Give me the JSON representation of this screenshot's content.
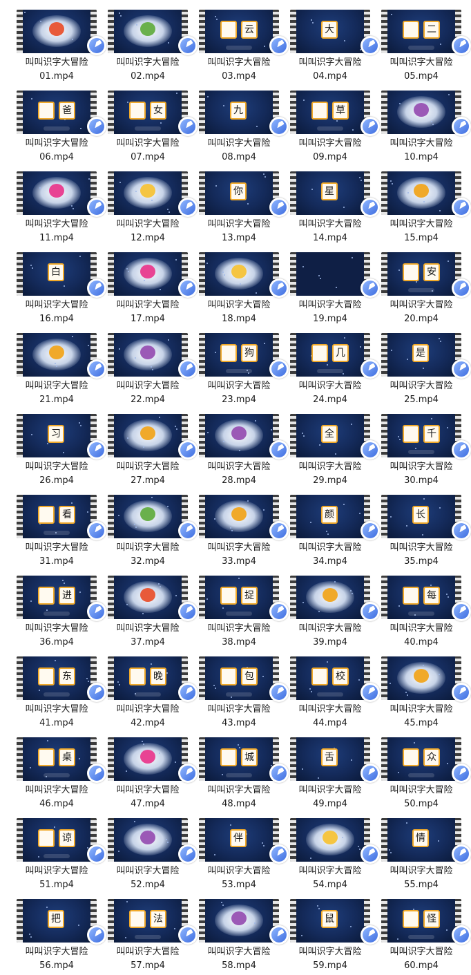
{
  "file_name_prefix": "叫叫识字大冒险",
  "items": [
    {
      "ext_name": "01.mp4",
      "chars": [],
      "thumb": "art"
    },
    {
      "ext_name": "02.mp4",
      "chars": [],
      "thumb": "art"
    },
    {
      "ext_name": "03.mp4",
      "chars": [
        "",
        "云"
      ],
      "thumb": "card"
    },
    {
      "ext_name": "04.mp4",
      "chars": [
        "大"
      ],
      "thumb": "card"
    },
    {
      "ext_name": "05.mp4",
      "chars": [
        "",
        "二"
      ],
      "thumb": "card"
    },
    {
      "ext_name": "06.mp4",
      "chars": [
        "",
        "爸"
      ],
      "thumb": "card"
    },
    {
      "ext_name": "07.mp4",
      "chars": [
        "",
        "女"
      ],
      "thumb": "card"
    },
    {
      "ext_name": "08.mp4",
      "chars": [
        "九"
      ],
      "thumb": "card"
    },
    {
      "ext_name": "09.mp4",
      "chars": [
        "",
        "草"
      ],
      "thumb": "card"
    },
    {
      "ext_name": "10.mp4",
      "chars": [],
      "thumb": "art"
    },
    {
      "ext_name": "11.mp4",
      "chars": [],
      "thumb": "art"
    },
    {
      "ext_name": "12.mp4",
      "chars": [],
      "thumb": "art"
    },
    {
      "ext_name": "13.mp4",
      "chars": [
        "你"
      ],
      "thumb": "card"
    },
    {
      "ext_name": "14.mp4",
      "chars": [
        "星"
      ],
      "thumb": "card"
    },
    {
      "ext_name": "15.mp4",
      "chars": [],
      "thumb": "art"
    },
    {
      "ext_name": "16.mp4",
      "chars": [
        "白"
      ],
      "thumb": "card"
    },
    {
      "ext_name": "17.mp4",
      "chars": [],
      "thumb": "art"
    },
    {
      "ext_name": "18.mp4",
      "chars": [],
      "thumb": "art"
    },
    {
      "ext_name": "19.mp4",
      "chars": [],
      "thumb": "dark"
    },
    {
      "ext_name": "20.mp4",
      "chars": [
        "",
        "安"
      ],
      "thumb": "card"
    },
    {
      "ext_name": "21.mp4",
      "chars": [],
      "thumb": "art"
    },
    {
      "ext_name": "22.mp4",
      "chars": [],
      "thumb": "art"
    },
    {
      "ext_name": "23.mp4",
      "chars": [
        "",
        "狗"
      ],
      "thumb": "card"
    },
    {
      "ext_name": "24.mp4",
      "chars": [
        "",
        "几"
      ],
      "thumb": "card"
    },
    {
      "ext_name": "25.mp4",
      "chars": [
        "是"
      ],
      "thumb": "card"
    },
    {
      "ext_name": "26.mp4",
      "chars": [
        "习"
      ],
      "thumb": "card"
    },
    {
      "ext_name": "27.mp4",
      "chars": [],
      "thumb": "art"
    },
    {
      "ext_name": "28.mp4",
      "chars": [],
      "thumb": "art"
    },
    {
      "ext_name": "29.mp4",
      "chars": [
        "全"
      ],
      "thumb": "card"
    },
    {
      "ext_name": "30.mp4",
      "chars": [
        "",
        "千"
      ],
      "thumb": "card"
    },
    {
      "ext_name": "31.mp4",
      "chars": [
        "",
        "看"
      ],
      "thumb": "card"
    },
    {
      "ext_name": "32.mp4",
      "chars": [],
      "thumb": "art"
    },
    {
      "ext_name": "33.mp4",
      "chars": [],
      "thumb": "art"
    },
    {
      "ext_name": "34.mp4",
      "chars": [
        "颜"
      ],
      "thumb": "card"
    },
    {
      "ext_name": "35.mp4",
      "chars": [
        "长"
      ],
      "thumb": "card"
    },
    {
      "ext_name": "36.mp4",
      "chars": [
        "",
        "进"
      ],
      "thumb": "card"
    },
    {
      "ext_name": "37.mp4",
      "chars": [],
      "thumb": "art"
    },
    {
      "ext_name": "38.mp4",
      "chars": [
        "",
        "捉"
      ],
      "thumb": "card"
    },
    {
      "ext_name": "39.mp4",
      "chars": [],
      "thumb": "art"
    },
    {
      "ext_name": "40.mp4",
      "chars": [
        "",
        "每"
      ],
      "thumb": "card"
    },
    {
      "ext_name": "41.mp4",
      "chars": [
        "",
        "东"
      ],
      "thumb": "card"
    },
    {
      "ext_name": "42.mp4",
      "chars": [
        "",
        "晚"
      ],
      "thumb": "card"
    },
    {
      "ext_name": "43.mp4",
      "chars": [
        "",
        "包"
      ],
      "thumb": "card"
    },
    {
      "ext_name": "44.mp4",
      "chars": [
        "",
        "校"
      ],
      "thumb": "card"
    },
    {
      "ext_name": "45.mp4",
      "chars": [],
      "thumb": "art"
    },
    {
      "ext_name": "46.mp4",
      "chars": [
        "",
        "桌"
      ],
      "thumb": "card"
    },
    {
      "ext_name": "47.mp4",
      "chars": [],
      "thumb": "art"
    },
    {
      "ext_name": "48.mp4",
      "chars": [
        "",
        "城"
      ],
      "thumb": "card"
    },
    {
      "ext_name": "49.mp4",
      "chars": [
        "舌"
      ],
      "thumb": "card"
    },
    {
      "ext_name": "50.mp4",
      "chars": [
        "",
        "众"
      ],
      "thumb": "card"
    },
    {
      "ext_name": "51.mp4",
      "chars": [
        "",
        "谅"
      ],
      "thumb": "card"
    },
    {
      "ext_name": "52.mp4",
      "chars": [],
      "thumb": "art"
    },
    {
      "ext_name": "53.mp4",
      "chars": [
        "伴"
      ],
      "thumb": "card"
    },
    {
      "ext_name": "54.mp4",
      "chars": [],
      "thumb": "art"
    },
    {
      "ext_name": "55.mp4",
      "chars": [
        "情"
      ],
      "thumb": "card"
    },
    {
      "ext_name": "56.mp4",
      "chars": [
        "把"
      ],
      "thumb": "card"
    },
    {
      "ext_name": "57.mp4",
      "chars": [
        "",
        "法"
      ],
      "thumb": "card"
    },
    {
      "ext_name": "58.mp4",
      "chars": [],
      "thumb": "art"
    },
    {
      "ext_name": "59.mp4",
      "chars": [
        "鼠"
      ],
      "thumb": "card"
    },
    {
      "ext_name": "60.mp4",
      "chars": [
        "",
        "怪"
      ],
      "thumb": "card"
    }
  ],
  "icons": {
    "play_badge": "play-circle-icon"
  },
  "colors": {
    "scene_bg": "#142a5a",
    "card_border": "#f0a92a",
    "play_blue": "#3f6ee0"
  }
}
